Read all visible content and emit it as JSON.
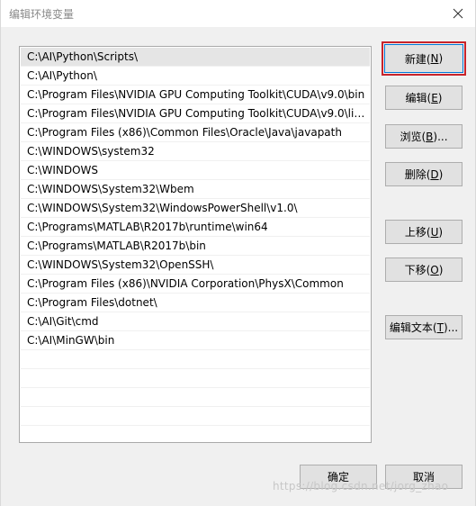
{
  "window": {
    "title": "编辑环境变量",
    "close_icon": "close-icon"
  },
  "path_list": {
    "items": [
      "C:\\AI\\Python\\Scripts\\",
      "C:\\AI\\Python\\",
      "C:\\Program Files\\NVIDIA GPU Computing Toolkit\\CUDA\\v9.0\\bin",
      "C:\\Program Files\\NVIDIA GPU Computing Toolkit\\CUDA\\v9.0\\lib...",
      "C:\\Program Files (x86)\\Common Files\\Oracle\\Java\\javapath",
      "C:\\WINDOWS\\system32",
      "C:\\WINDOWS",
      "C:\\WINDOWS\\System32\\Wbem",
      "C:\\WINDOWS\\System32\\WindowsPowerShell\\v1.0\\",
      "C:\\Programs\\MATLAB\\R2017b\\runtime\\win64",
      "C:\\Programs\\MATLAB\\R2017b\\bin",
      "C:\\WINDOWS\\System32\\OpenSSH\\",
      "C:\\Program Files (x86)\\NVIDIA Corporation\\PhysX\\Common",
      "C:\\Program Files\\dotnet\\",
      "C:\\AI\\Git\\cmd",
      "C:\\AI\\MinGW\\bin"
    ],
    "selected_index": 0
  },
  "buttons": {
    "new": {
      "label": "新建(",
      "key": "N",
      "tail": ")"
    },
    "edit": {
      "label": "编辑(",
      "key": "E",
      "tail": ")"
    },
    "browse": {
      "label": "浏览(",
      "key": "B",
      "tail": ")..."
    },
    "delete": {
      "label": "删除(",
      "key": "D",
      "tail": ")"
    },
    "move_up": {
      "label": "上移(",
      "key": "U",
      "tail": ")"
    },
    "move_down": {
      "label": "下移(",
      "key": "O",
      "tail": ")"
    },
    "edit_text": {
      "label": "编辑文本(",
      "key": "T",
      "tail": ")..."
    },
    "ok": {
      "label": "确定"
    },
    "cancel": {
      "label": "取消"
    }
  },
  "watermark": {
    "text": "https://blog.csdn.net/jorg_zhao"
  },
  "colors": {
    "default_button_highlight": "#c8232b",
    "selected_row": "#e5e5e5"
  }
}
